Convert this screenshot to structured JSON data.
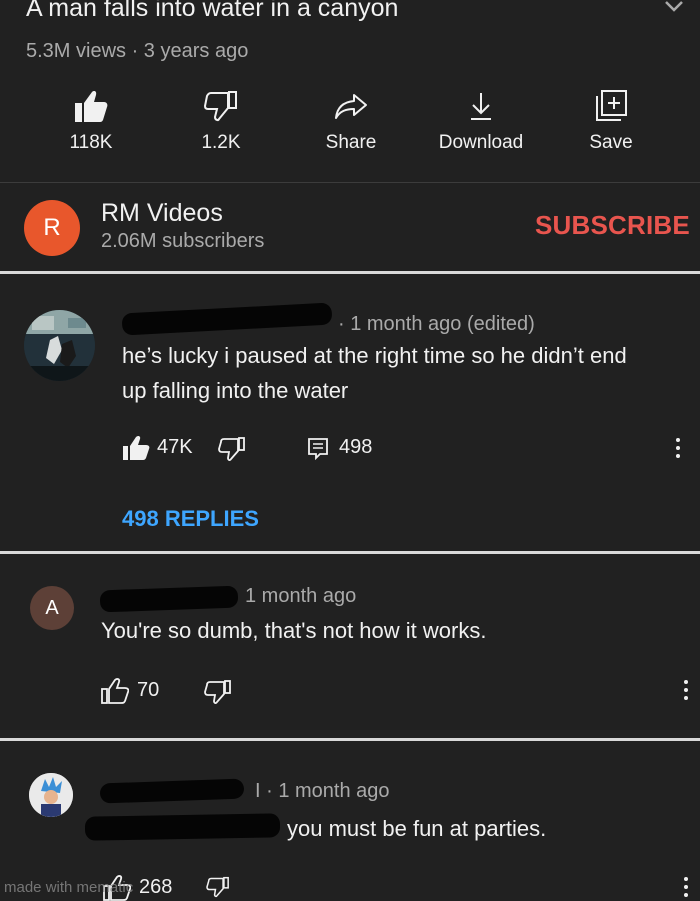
{
  "video": {
    "title": "A man falls into water in a canyon",
    "meta": "5.3M views · 3 years ago"
  },
  "actions": [
    {
      "icon": "thumbs-up-filled-icon",
      "label": "118K"
    },
    {
      "icon": "thumbs-down-icon",
      "label": "1.2K"
    },
    {
      "icon": "share-icon",
      "label": "Share"
    },
    {
      "icon": "download-icon",
      "label": "Download"
    },
    {
      "icon": "save-playlist-icon",
      "label": "Save"
    }
  ],
  "channel": {
    "avatar_letter": "R",
    "avatar_color": "#e8572c",
    "name": "RM Videos",
    "subscribers": "2.06M subscribers",
    "subscribe_label": "SUBSCRIBE",
    "subscribe_color": "#e8554e"
  },
  "comments": [
    {
      "meta": "· 1 month ago (edited)",
      "text_line1": "he’s lucky i paused at the right time so he didn’t end",
      "text_line2": "up falling into the water",
      "likes": "47K",
      "reply_count": "498",
      "replies_label": "498 REPLIES"
    },
    {
      "avatar_letter": "A",
      "avatar_color": "#5d4037",
      "meta": "1 month ago",
      "text": "You're so dumb, that's not how it works.",
      "likes": "70"
    },
    {
      "meta": "I · 1 month ago",
      "text": "you must be fun at parties.",
      "likes": "268"
    }
  ],
  "watermark": "made with mematic"
}
